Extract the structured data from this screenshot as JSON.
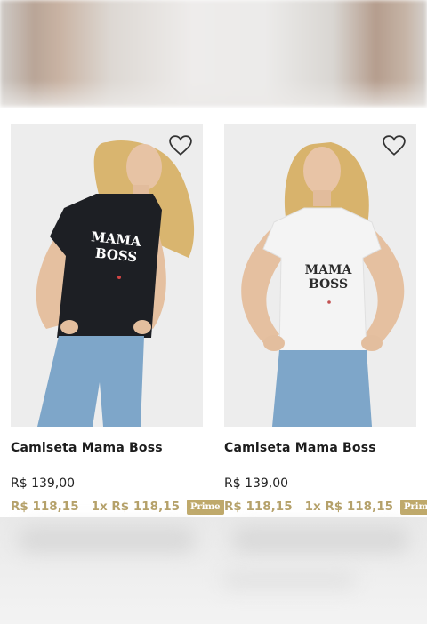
{
  "products": [
    {
      "name": "Camiseta Mama Boss",
      "shirt_text_line1": "MAMA",
      "shirt_text_line2": "BOSS",
      "shirt_color": "#1d1f24",
      "print_color": "#ffffff",
      "price": "R$ 139,00",
      "promo_price": "R$ 118,15",
      "installment": "1x R$ 118,15",
      "badge": "Prime"
    },
    {
      "name": "Camiseta Mama Boss",
      "shirt_text_line1": "MAMA",
      "shirt_text_line2": "BOSS",
      "shirt_color": "#f4f4f4",
      "print_color": "#2b2b2b",
      "price": "R$ 139,00",
      "promo_price": "R$ 118,15",
      "installment": "1x R$ 118,15",
      "badge": "Prime"
    }
  ],
  "colors": {
    "promo": "#b5a16a",
    "badge_bg": "#bfa96b",
    "photo_bg": "#eeeeee",
    "jeans": "#7ea6c9"
  },
  "icons": {
    "wishlist": "heart-outline-icon"
  }
}
